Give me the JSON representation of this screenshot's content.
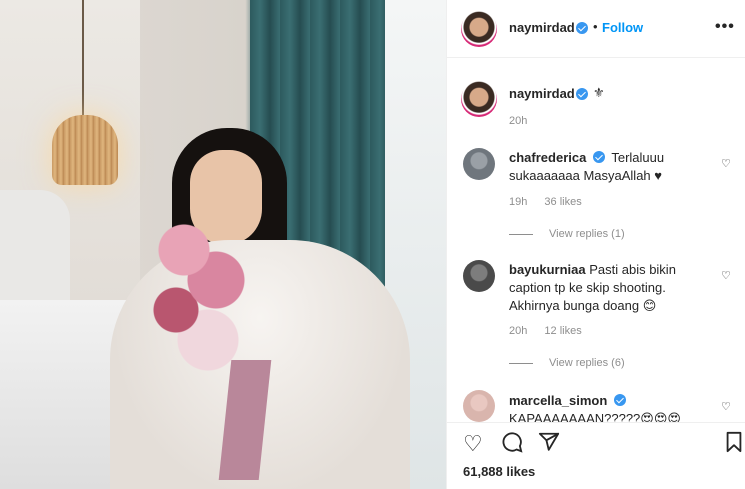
{
  "post": {
    "username": "naymirdad",
    "follow_label": "Follow",
    "more_label": "•••",
    "caption_emoji": "⚜",
    "caption_time": "20h"
  },
  "comments": [
    {
      "username": "chafrederica",
      "verified": true,
      "text": "Terlaluuu sukaaaaaaa MasyaAllah ♥",
      "time": "19h",
      "likes": "36 likes",
      "view_replies": "View replies (1)"
    },
    {
      "username": "bayukurniaa",
      "verified": false,
      "text": "Pasti abis bikin caption tp ke skip shooting. Akhirnya bunga doang 😊",
      "time": "20h",
      "likes": "12 likes",
      "view_replies": "View replies (6)"
    },
    {
      "username": "marcella_simon",
      "verified": true,
      "text": "KAPAAAAAAAN?????😍😍😍"
    }
  ],
  "actions": {
    "like_icon": "heart-icon",
    "comment_icon": "comment-icon",
    "share_icon": "share-icon",
    "save_icon": "bookmark-icon",
    "likes_count": "61,888 likes"
  },
  "colors": {
    "accent": "#0095f6",
    "verified": "#3897f0",
    "muted": "#8e8e8e"
  }
}
